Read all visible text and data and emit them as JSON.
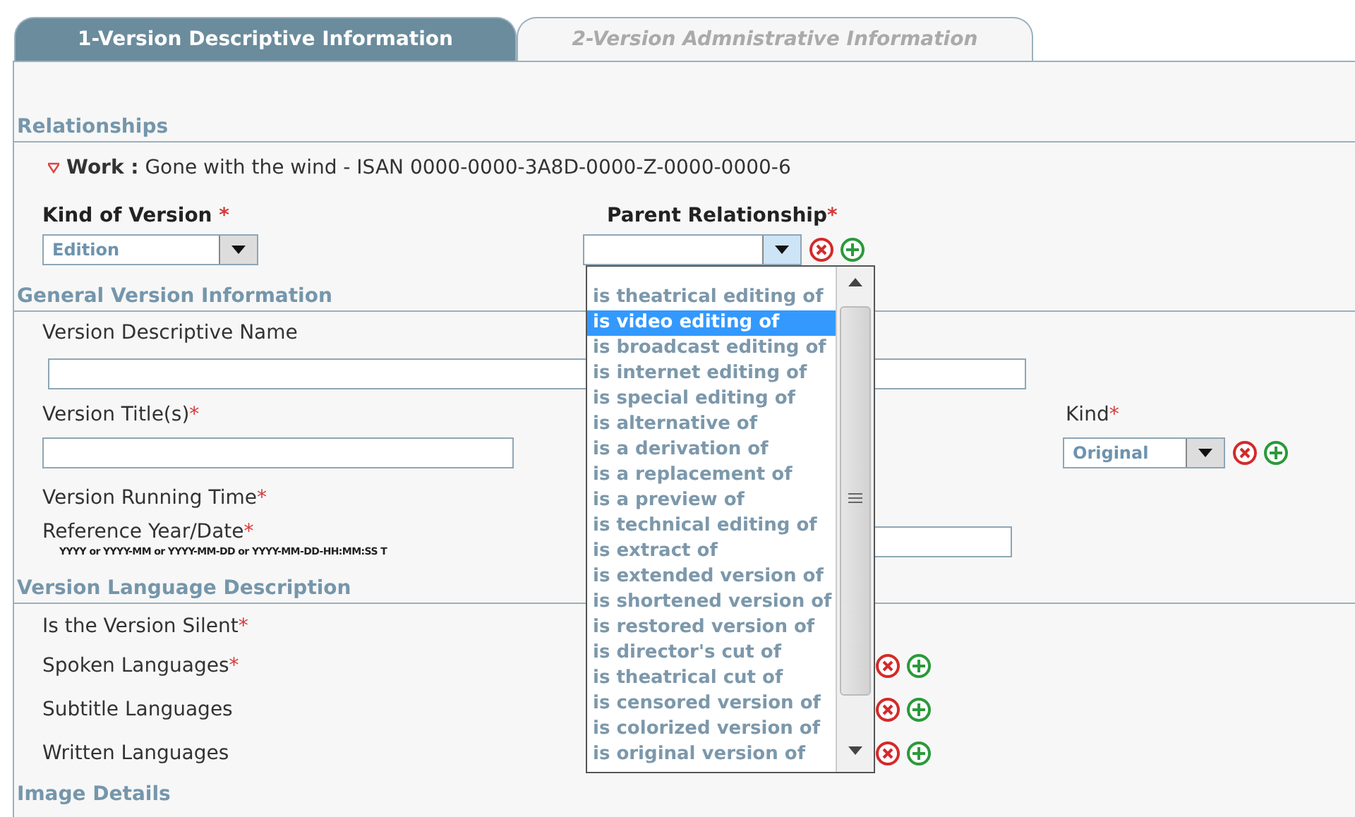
{
  "tabs": [
    {
      "label": "1-Version Descriptive Information",
      "selected": true
    },
    {
      "label": "2-Version Admnistrative Information",
      "selected": false
    }
  ],
  "relationships": {
    "heading": "Relationships",
    "work": "**Work :** Gone with the wind - ISAN 0000-0000-3A8D-0000-Z-0000-0000-6",
    "expanded": true,
    "kind_of_version": {
      "label": "Kind of Version ",
      "required_mark": "*",
      "value": "Edition"
    },
    "parent_relationship": {
      "label": "Parent Relationship",
      "required_mark": "*",
      "open": true,
      "options": [
        {
          "label": "is theatrical editing of",
          "selected": false
        },
        {
          "label": "is video editing of",
          "selected": true
        },
        {
          "label": "is broadcast editing of",
          "selected": false
        },
        {
          "label": "is internet editing of",
          "selected": false
        },
        {
          "label": "is special editing of",
          "selected": false
        },
        {
          "label": "is alternative of",
          "selected": false
        },
        {
          "label": "is a derivation of",
          "selected": false
        },
        {
          "label": "is a replacement of",
          "selected": false
        },
        {
          "label": "is a preview of",
          "selected": false
        },
        {
          "label": "is technical editing of",
          "selected": false
        },
        {
          "label": "is extract of",
          "selected": false
        },
        {
          "label": "is extended version of",
          "selected": false
        },
        {
          "label": "is shortened version of",
          "selected": false
        },
        {
          "label": "is restored version of",
          "selected": false
        },
        {
          "label": "is director's cut of",
          "selected": false
        },
        {
          "label": "is theatrical cut of",
          "selected": false
        },
        {
          "label": "is censored version of",
          "selected": false
        },
        {
          "label": "is colorized version of",
          "selected": false
        },
        {
          "label": "is original version of",
          "selected": false
        }
      ]
    }
  },
  "general": {
    "heading": "General Version Information",
    "descriptive_name": {
      "label": "Version Descriptive Name"
    },
    "titles": {
      "label": "Version Title(s)",
      "required_mark": "*"
    },
    "kind": {
      "label": "Kind",
      "required_mark": "*",
      "value": "Original"
    },
    "running_time": {
      "label": "Version Running Time",
      "required_mark": "*"
    },
    "reference_date": {
      "label": "Reference Year/Date",
      "required_mark": "*",
      "hint": "YYYY or YYYY-MM or YYYY-MM-DD or YYYY-MM-DD-HH:MM:SS T"
    }
  },
  "language": {
    "heading": "Version Language Description",
    "rows": [
      {
        "label": "Is the Version Silent",
        "required_mark": "*",
        "controls": false
      },
      {
        "label": "Spoken Languages",
        "required_mark": "*",
        "controls": true
      },
      {
        "label": "Subtitle Languages",
        "controls": true
      },
      {
        "label": "Written Languages",
        "controls": true
      }
    ]
  },
  "image": {
    "heading": "Image Details"
  }
}
